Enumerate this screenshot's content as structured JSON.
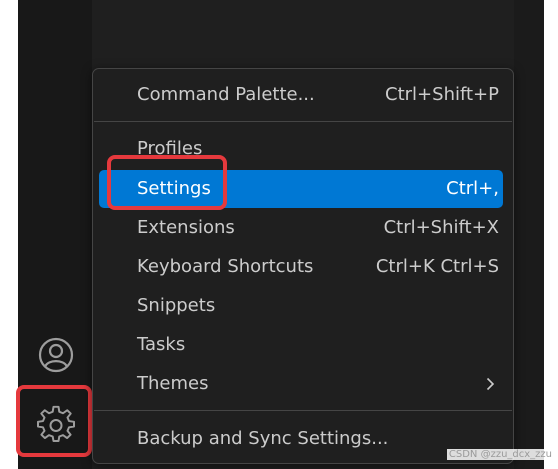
{
  "activity_bar": {
    "icons": [
      "account-icon",
      "gear-icon"
    ]
  },
  "menu": {
    "items": [
      {
        "label": "Command Palette...",
        "shortcut": "Ctrl+Shift+P"
      },
      {
        "label": "Profiles",
        "shortcut": ""
      },
      {
        "label": "Settings",
        "shortcut": "Ctrl+,",
        "selected": true
      },
      {
        "label": "Extensions",
        "shortcut": "Ctrl+Shift+X"
      },
      {
        "label": "Keyboard Shortcuts",
        "shortcut": "Ctrl+K Ctrl+S"
      },
      {
        "label": "Snippets",
        "shortcut": ""
      },
      {
        "label": "Tasks",
        "shortcut": ""
      },
      {
        "label": "Themes",
        "shortcut": "",
        "submenu_icon": "chevron-right-icon"
      },
      {
        "label": "Backup and Sync Settings...",
        "shortcut": ""
      }
    ]
  },
  "colors": {
    "selection": "#0078d4",
    "annotation": "#e5393d",
    "menu_background": "#1f1f1f",
    "activity_bar_background": "#181818",
    "menu_text": "#cccccc"
  },
  "watermark": "CSDN @zzu_dcx_zzu"
}
